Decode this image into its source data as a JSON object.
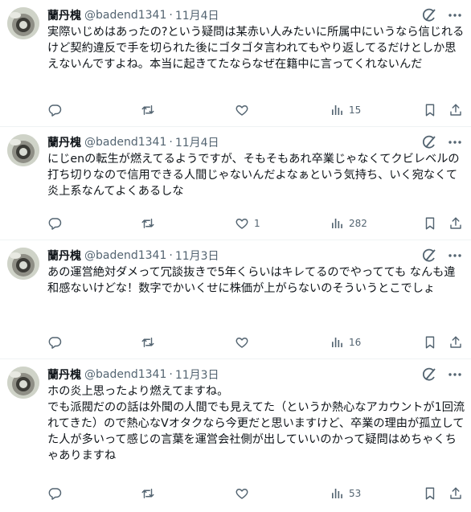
{
  "author": {
    "name": "蘭丹槐",
    "handle": "@badend1341",
    "dot": "·"
  },
  "icons": {
    "reply": "reply-bubble-icon",
    "retweet": "retweet-icon",
    "like": "heart-icon",
    "views": "bar-chart-icon",
    "bookmark": "bookmark-icon",
    "share": "share-upload-icon",
    "grok": "grok-icon",
    "more": "more-dots-icon"
  },
  "colors": {
    "text": "#0f1419",
    "secondary": "#536471",
    "divider": "#eff3f4"
  },
  "tweets": [
    {
      "date": "11月4日",
      "text": "実際いじめはあったの?という疑問は某赤い人みたいに所属中にいうなら信じれるけど契約違反で手を切られた後にゴタゴタ言われてもやり返してるだけとしか思えないんですよね。本当に起きてたならなぜ在籍中に言ってくれないんだ",
      "views": "15",
      "likes": ""
    },
    {
      "date": "11月4日",
      "text": "にじenの転生が燃えてるようですが、そもそもあれ卒業じゃなくてクビレベルの打ち切りなので信用できる人間じゃないんだよなぁという気持ち、いく宛なくて炎上系なんてよくあるしな",
      "views": "282",
      "likes": "1"
    },
    {
      "date": "11月3日",
      "text": "あの運営絶対ダメって冗談抜きで5年くらいはキレてるのでやってても なんも違和感ないけどな！数字でかいくせに株価が上がらないのそういうとこでしょ",
      "views": "16",
      "likes": ""
    },
    {
      "date": "11月3日",
      "text": "ホの炎上思ったより燃えてますね。\nでも派閥だのの話は外聞の人間でも見えてた（というか熱心なアカウントが1回流れてきた）ので熱心なVオタクなら今更だと思いますけど、卒業の理由が孤立してた人が多いって感じの言葉を運営会社側が出していいのかって疑問はめちゃくちゃありますね",
      "views": "53",
      "likes": ""
    }
  ]
}
